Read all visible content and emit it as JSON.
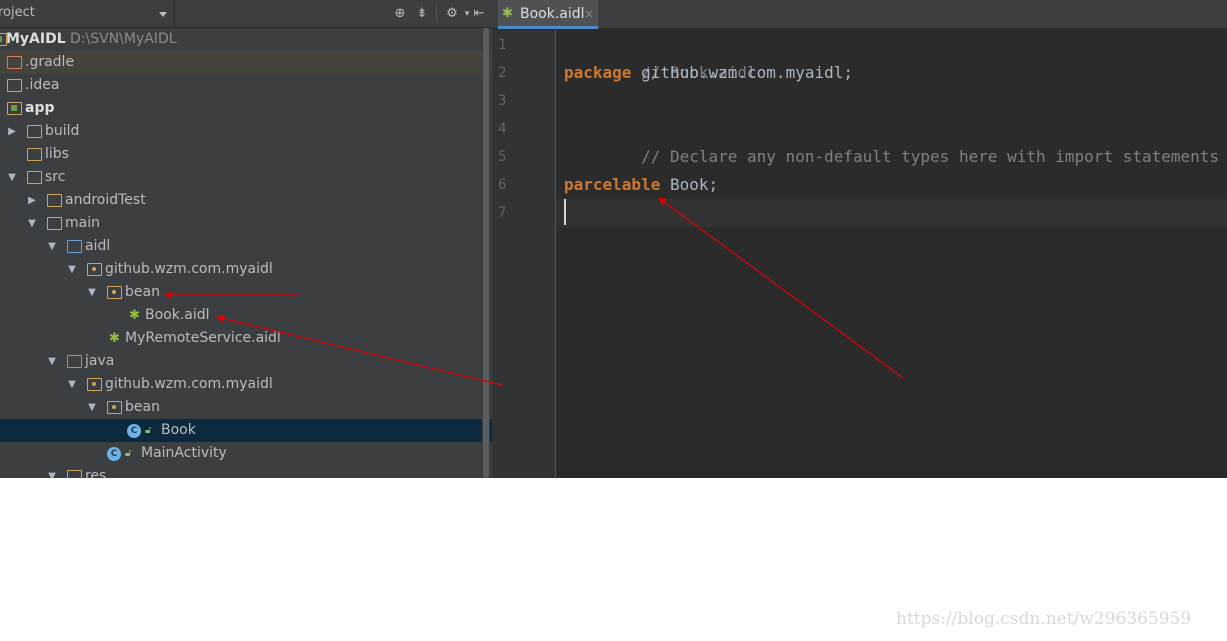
{
  "project_panel": {
    "view_label": "roject",
    "toolbar_icons": [
      "crosshair-icon",
      "collapse-icon",
      "gear-icon",
      "hide-icon"
    ],
    "tree": [
      {
        "label": "MyAIDL",
        "path": "D:\\SVN\\MyAIDL",
        "icon": "module-icon"
      },
      {
        "label": ".gradle",
        "icon": "folder-icon"
      },
      {
        "label": ".idea",
        "icon": "folder-icon"
      },
      {
        "label": "app",
        "icon": "module-folder-icon"
      },
      {
        "label": "build",
        "icon": "folder-icon",
        "expanded": false
      },
      {
        "label": "libs",
        "icon": "folder-icon"
      },
      {
        "label": "src",
        "icon": "folder-icon",
        "expanded": true
      },
      {
        "label": "androidTest",
        "icon": "folder-icon",
        "expanded": false
      },
      {
        "label": "main",
        "icon": "folder-icon",
        "expanded": true
      },
      {
        "label": "aidl",
        "icon": "source-folder-icon",
        "expanded": true
      },
      {
        "label": "github.wzm.com.myaidl",
        "icon": "package-icon",
        "expanded": true
      },
      {
        "label": "bean",
        "icon": "package-icon",
        "expanded": true
      },
      {
        "label": "Book.aidl",
        "icon": "android-icon"
      },
      {
        "label": "MyRemoteService.aidl",
        "icon": "android-icon"
      },
      {
        "label": "java",
        "icon": "source-folder-icon",
        "expanded": true
      },
      {
        "label": "github.wzm.com.myaidl",
        "icon": "package-icon",
        "expanded": true
      },
      {
        "label": "bean",
        "icon": "package-icon",
        "expanded": true
      },
      {
        "label": "Book",
        "icon": "class-icon",
        "selected": true
      },
      {
        "label": "MainActivity",
        "icon": "class-icon"
      },
      {
        "label": "res",
        "icon": "res-folder-icon",
        "expanded": true
      }
    ]
  },
  "editor": {
    "tab": {
      "label": "Book.aidl",
      "close": "×",
      "icon": "android-icon"
    },
    "line_numbers": [
      "1",
      "2",
      "3",
      "4",
      "5",
      "6",
      "7"
    ],
    "lines": {
      "l1": "// Book.aidl",
      "l2_kw": "package",
      "l2_rest": " github.wzm.com.myaidl;",
      "l3": "",
      "l4": "// Declare any non-default types here with import statements",
      "l5": "",
      "l6_kw": "parcelable",
      "l6_rest": " Book;",
      "l7": ""
    }
  },
  "colors": {
    "panel_bg": "#3c3f41",
    "editor_bg": "#2b2b2b",
    "keyword": "#cc7832",
    "comment": "#808080",
    "annotation_arrow": "#e00000"
  },
  "watermark": "https://blog.csdn.net/w296365959"
}
